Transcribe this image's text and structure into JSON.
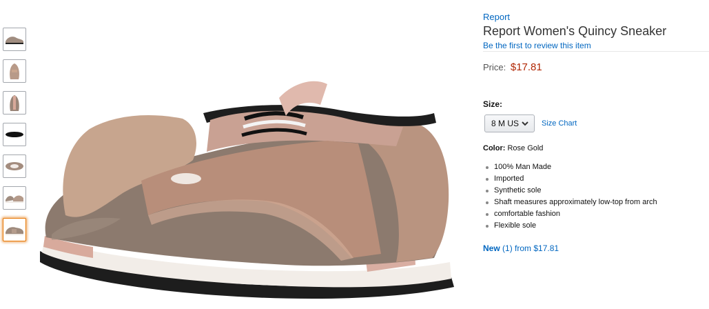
{
  "thumbnails": [
    {
      "name": "thumbnail-side-view",
      "selected": false
    },
    {
      "name": "thumbnail-front-view",
      "selected": false
    },
    {
      "name": "thumbnail-back-view",
      "selected": false
    },
    {
      "name": "thumbnail-sole-view",
      "selected": false
    },
    {
      "name": "thumbnail-top-view",
      "selected": false
    },
    {
      "name": "thumbnail-pair-view",
      "selected": false
    },
    {
      "name": "thumbnail-angle-view",
      "selected": true
    }
  ],
  "product": {
    "brand": "Report",
    "title": "Report Women's Quincy Sneaker",
    "review_link": "Be the first to review this item",
    "price_label": "Price:",
    "price": "$17.81",
    "size_label": "Size:",
    "size_value": "8 M US",
    "size_chart": "Size Chart",
    "color_label": "Color:",
    "color_value": "Rose Gold",
    "features": [
      "100% Man Made",
      "Imported",
      "Synthetic sole",
      "Shaft measures approximately low-top from arch",
      "comfortable fashion",
      "Flexible sole"
    ],
    "offers_new": "New",
    "offers_rest": "(1) from $17.81"
  },
  "colors": {
    "link": "#0066c0",
    "price": "#b12704",
    "selected_thumb": "#e77600"
  }
}
